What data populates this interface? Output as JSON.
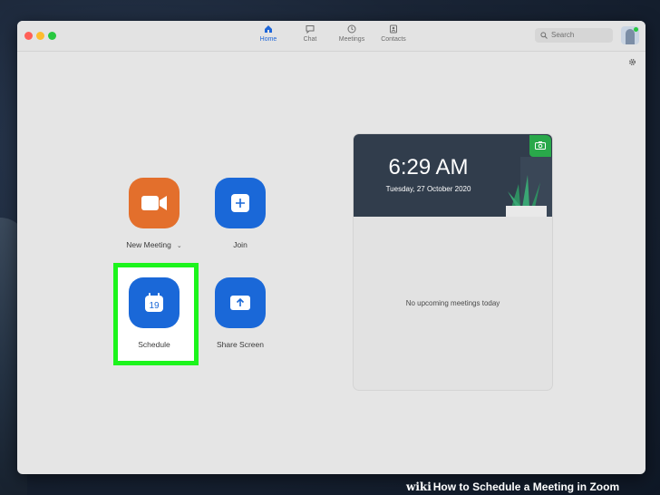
{
  "nav": {
    "tabs": [
      {
        "label": "Home",
        "icon": "home-icon",
        "active": true
      },
      {
        "label": "Chat",
        "icon": "chat-icon",
        "active": false
      },
      {
        "label": "Meetings",
        "icon": "clock-icon",
        "active": false
      },
      {
        "label": "Contacts",
        "icon": "contacts-icon",
        "active": false
      }
    ]
  },
  "search": {
    "placeholder": "Search"
  },
  "actions": {
    "new_meeting": {
      "label": "New Meeting",
      "icon": "video-camera-icon",
      "color": "#e36f2c"
    },
    "join": {
      "label": "Join",
      "icon": "plus-icon",
      "color": "#1a68d8"
    },
    "schedule": {
      "label": "Schedule",
      "icon": "calendar-icon",
      "day": "19",
      "color": "#1a68d8"
    },
    "share_screen": {
      "label": "Share Screen",
      "icon": "upload-arrow-icon",
      "color": "#1a68d8"
    }
  },
  "meetings_panel": {
    "time": "6:29 AM",
    "date": "Tuesday, 27 October 2020",
    "empty_message": "No upcoming meetings today"
  },
  "watermark": {
    "brand": "wiki",
    "title": "How to Schedule a Meeting in Zoom"
  },
  "colors": {
    "accent": "#1a68d8",
    "highlight": "#1cf41c",
    "orange": "#e36f2c"
  }
}
